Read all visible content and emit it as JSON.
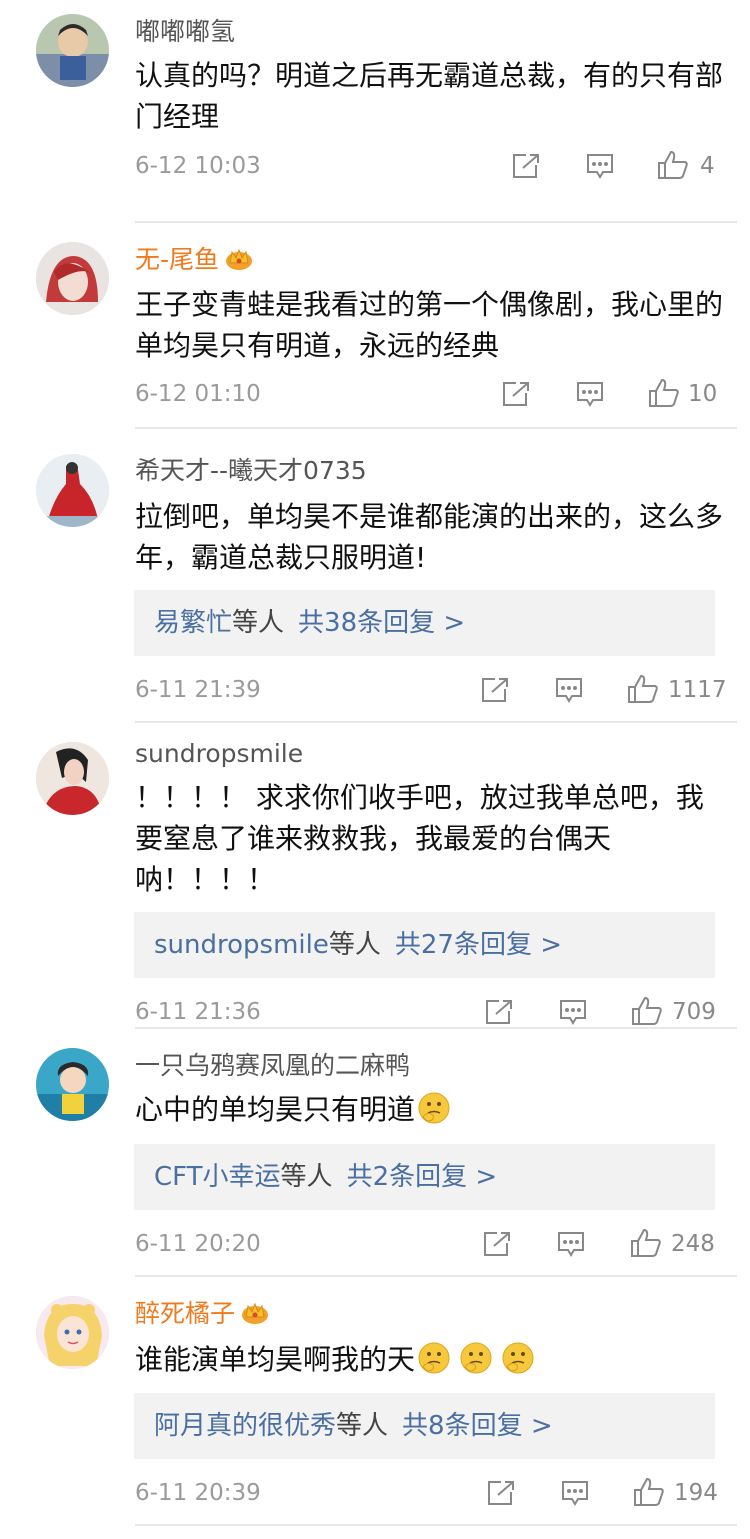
{
  "comments": [
    {
      "user": "嘟嘟嘟氢",
      "vip": false,
      "text": "认真的吗？明道之后再无霸道总裁，有的只有部门经理",
      "time": "6-12 10:03",
      "likes": "4"
    },
    {
      "user": "无-尾鱼",
      "vip": true,
      "text": "王子变青蛙是我看过的第一个偶像剧，我心里的单均昊只有明道，永远的经典",
      "time": "6-12 01:10",
      "likes": "10"
    },
    {
      "user": "希天才--曦天才0735",
      "vip": false,
      "text": "拉倒吧，单均昊不是谁都能演的出来的，这么多年，霸道总裁只服明道!",
      "reply_who": "易繁忙",
      "reply_etc": "等人",
      "reply_count": "共38条回复 >",
      "time": "6-11 21:39",
      "likes": "1117"
    },
    {
      "user": "sundropsmile",
      "vip": false,
      "text": "！！！！ 求求你们收手吧，放过我单总吧，我要窒息了谁来救救我，我最爱的台偶天呐！！！！",
      "reply_who": "sundropsmile",
      "reply_etc": "等人",
      "reply_count": "共27条回复 >",
      "time": "6-11 21:36",
      "likes": "709"
    },
    {
      "user": "一只乌鸦赛凤凰的二麻鸭",
      "vip": false,
      "text": "心中的单均昊只有明道",
      "reply_who": "CFT小幸运",
      "reply_etc": "等人",
      "reply_count": "共2条回复 >",
      "time": "6-11 20:20",
      "likes": "248"
    },
    {
      "user": "醉死橘子",
      "vip": true,
      "text": "谁能演单均昊啊我的天",
      "reply_who": "阿月真的很优秀",
      "reply_etc": "等人",
      "reply_count": "共8条回复 >",
      "time": "6-11 20:39",
      "likes": "194"
    }
  ],
  "icons": {
    "share": "share-icon",
    "comment": "comment-icon",
    "like": "thumbs-up-icon",
    "vip": "crown-icon",
    "emoji": "thinking-face-icon"
  },
  "colors": {
    "vip_name": "#f07a1e",
    "reply_link": "#4a6fa0",
    "reply_bg": "#f2f2f2"
  }
}
